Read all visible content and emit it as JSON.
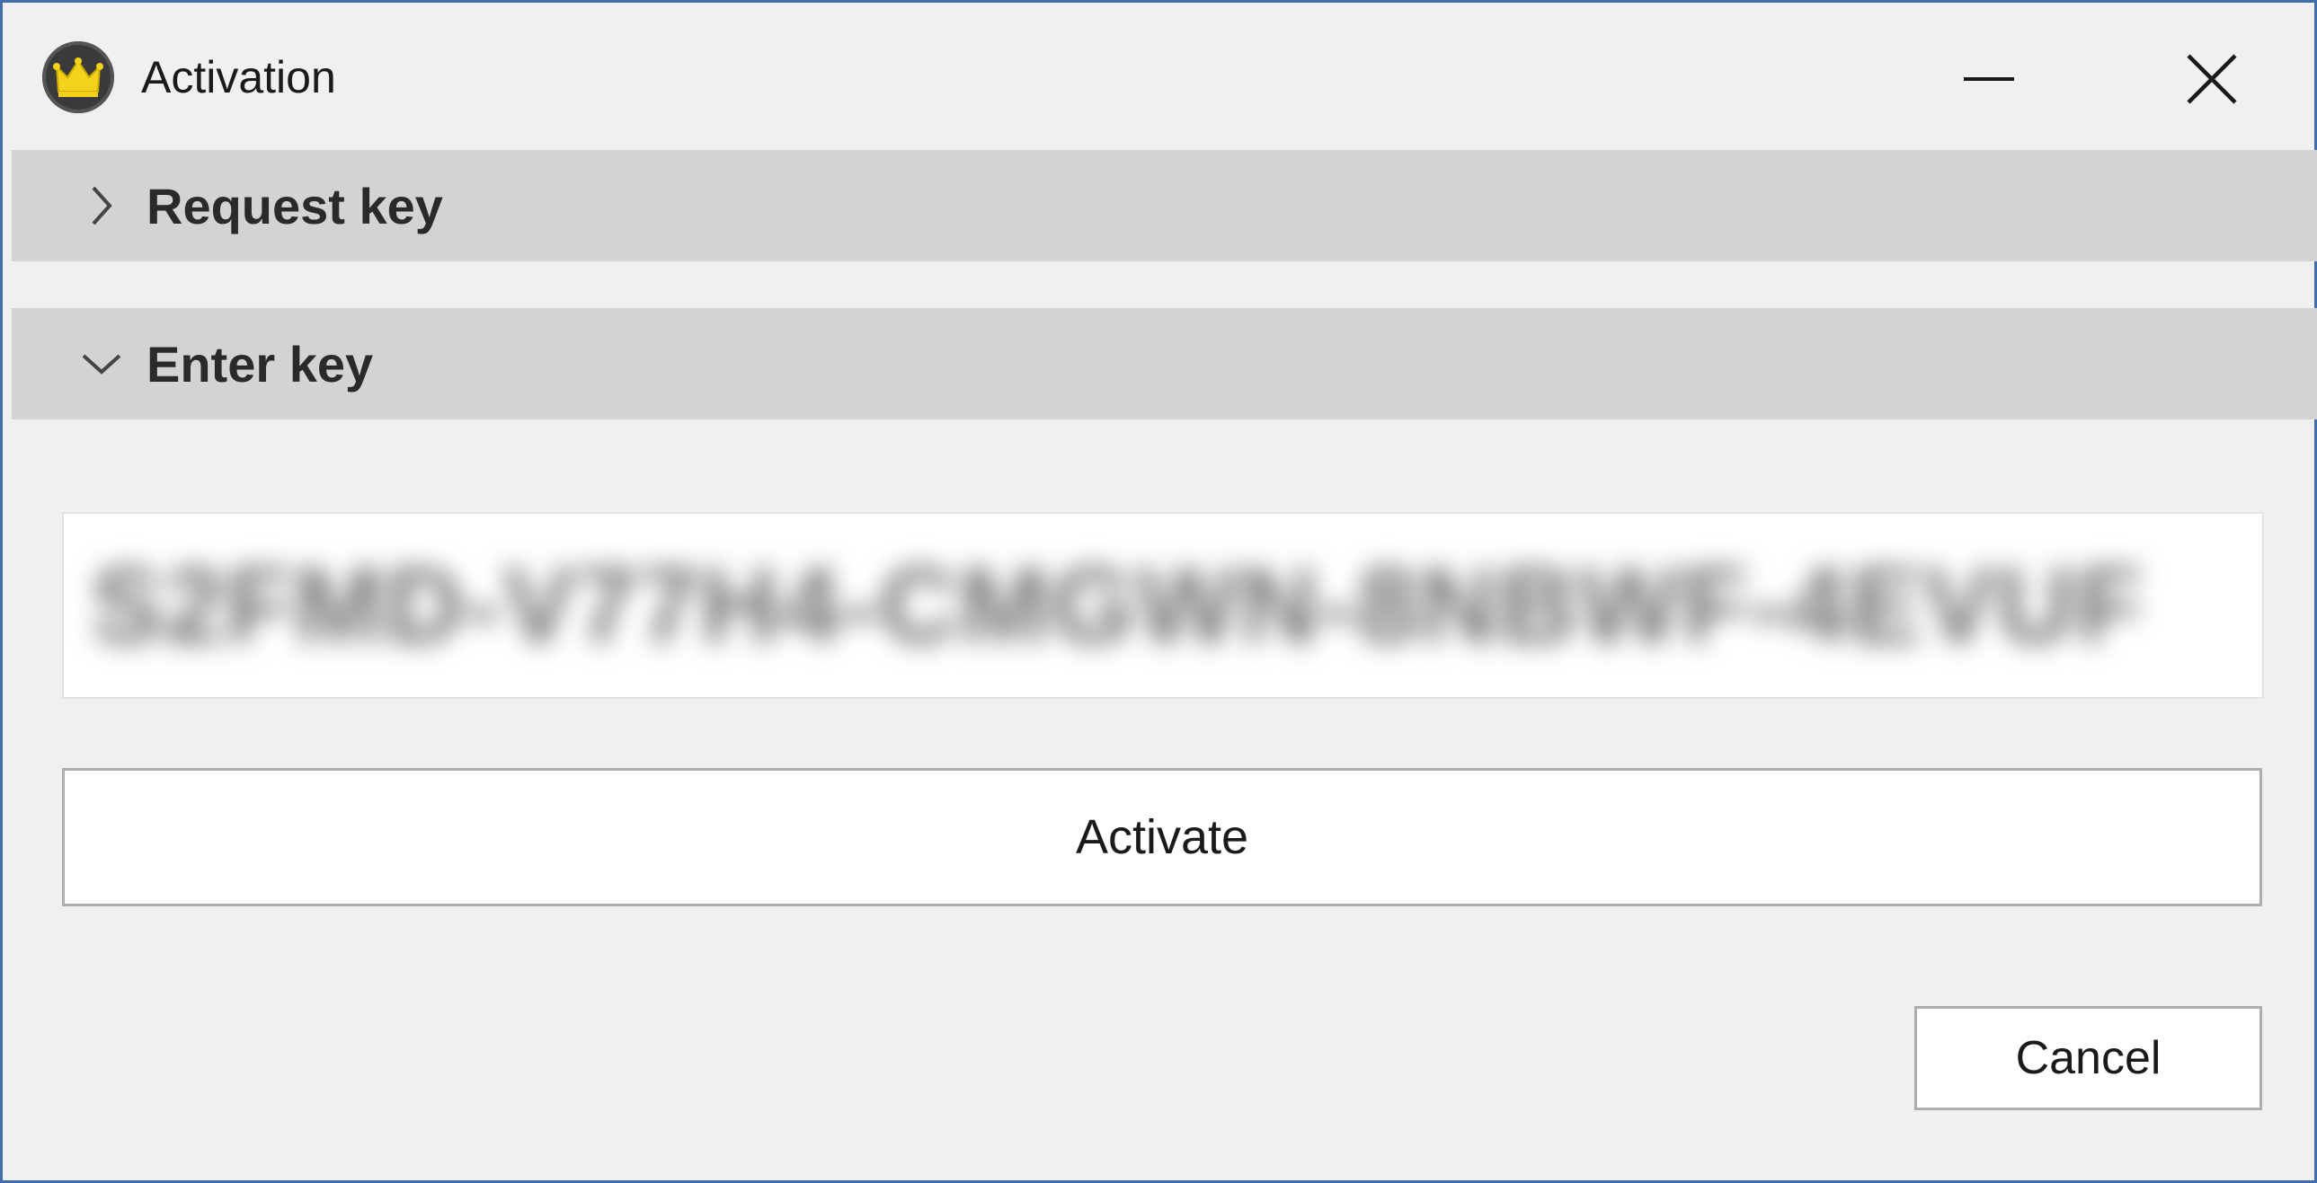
{
  "window": {
    "title": "Activation",
    "app_icon": "crown-icon",
    "accent_color": "#3f6ea8",
    "controls": {
      "minimize_icon": "minimize-icon",
      "close_icon": "close-icon"
    }
  },
  "sections": [
    {
      "label": "Request key",
      "expanded": false,
      "icon": "chevron-right-icon"
    },
    {
      "label": "Enter key",
      "expanded": true,
      "icon": "chevron-down-icon"
    }
  ],
  "enter_key": {
    "key_value": "S2FMD-V77H4-CMGWN-8NBWF-4EVUF",
    "obscured": true
  },
  "buttons": {
    "activate_label": "Activate",
    "cancel_label": "Cancel"
  }
}
